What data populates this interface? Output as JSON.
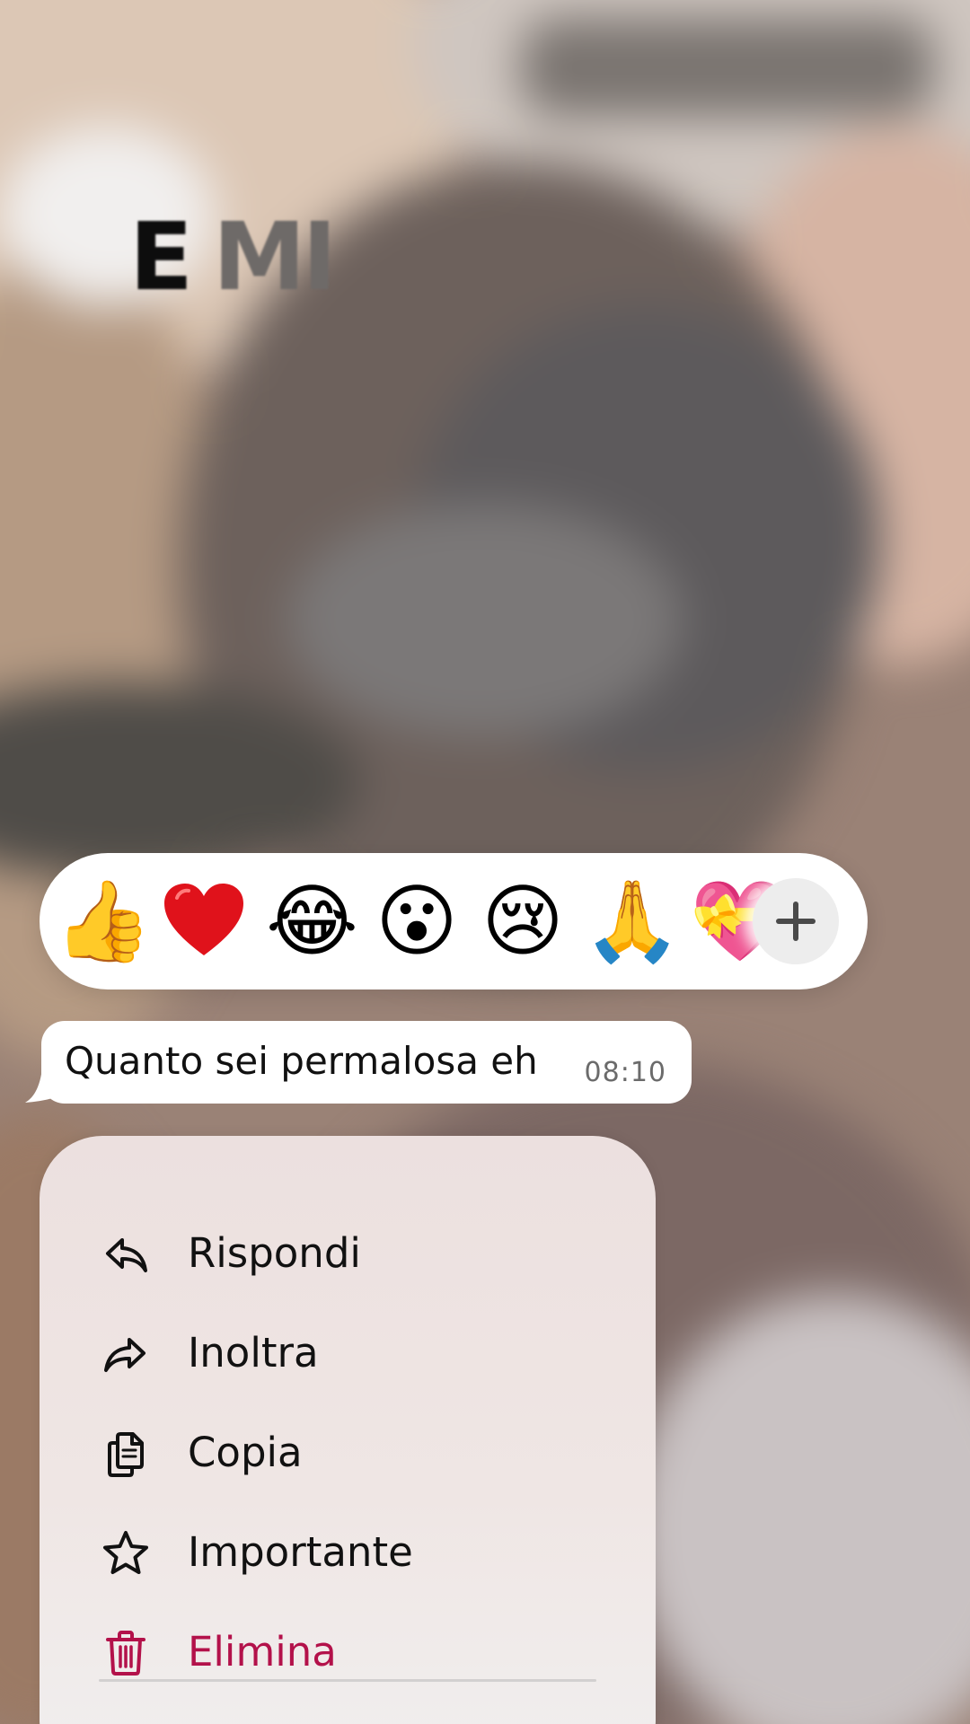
{
  "background": {
    "title_part1": "E",
    "title_part2": "MI"
  },
  "reactions": {
    "items": [
      {
        "name": "thumbs-up",
        "glyph": "👍"
      },
      {
        "name": "red-heart",
        "glyph": "❤️"
      },
      {
        "name": "tears-of-joy",
        "glyph": "😂"
      },
      {
        "name": "surprised",
        "glyph": "😮"
      },
      {
        "name": "crying",
        "glyph": "😢"
      },
      {
        "name": "folded-hands",
        "glyph": "🙏"
      },
      {
        "name": "heart-with-ribbon",
        "glyph": "💝"
      }
    ],
    "more_icon": "plus-icon"
  },
  "message": {
    "text": "Quanto sei permalosa eh",
    "time": "08:10"
  },
  "menu": {
    "items": [
      {
        "label": "Rispondi",
        "icon": "reply-icon"
      },
      {
        "label": "Inoltra",
        "icon": "forward-icon"
      },
      {
        "label": "Copia",
        "icon": "copy-icon"
      },
      {
        "label": "Importante",
        "icon": "star-icon"
      },
      {
        "label": "Elimina",
        "icon": "trash-icon",
        "color": "#b3114a"
      }
    ]
  },
  "colors": {
    "danger": "#b3114a",
    "bubble": "#ffffff",
    "menu_background": "#efe6e4"
  }
}
